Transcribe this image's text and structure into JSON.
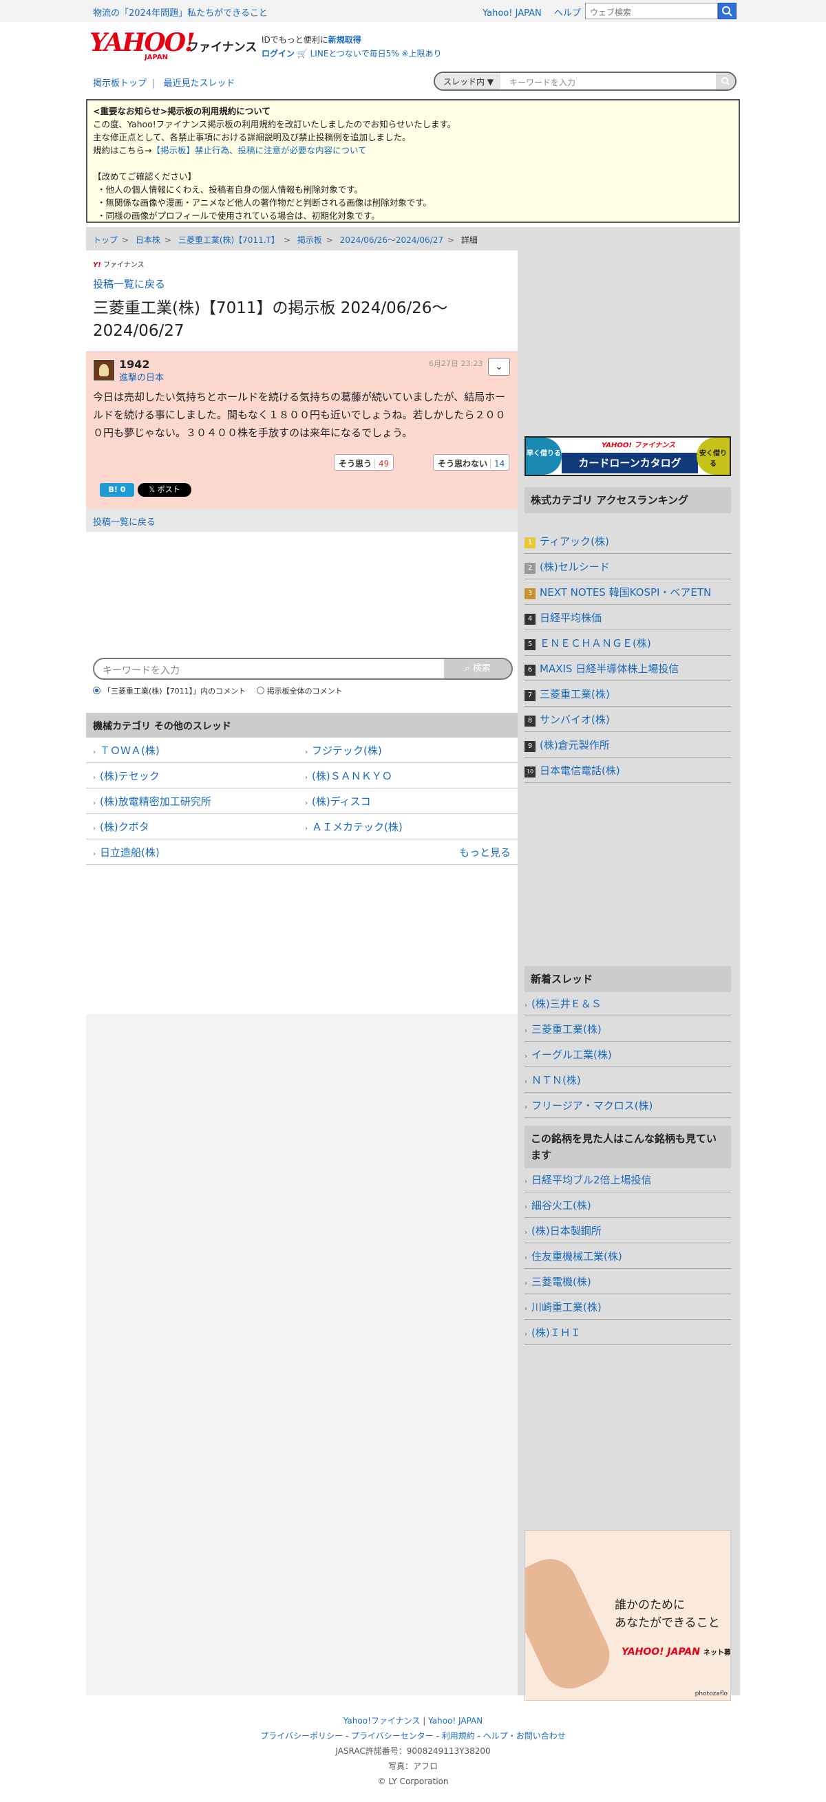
{
  "topbar": {
    "news": "物流の「2024年問題」私たちができること",
    "yahoo_japan": "Yahoo! JAPAN",
    "help": "ヘルプ",
    "search_placeholder": "ウェブ検索"
  },
  "header": {
    "logo_text": "YAHOO!",
    "logo_sub": "JAPAN",
    "finance": "ファイナンス",
    "promo_line1_a": "IDでもっと便利に",
    "promo_line1_b": "新規取得",
    "promo_login": "ログイン",
    "promo_line2": "LINEとつないで毎日5% ※上限あり",
    "nav_board_top": "掲示板トップ",
    "nav_recent": "最近見たスレッド",
    "scope": "スレッド内",
    "search_placeholder": "キーワードを入力"
  },
  "notice": {
    "title": "<重要なお知らせ>掲示板の利用規約について",
    "line1": "この度、Yahoo!ファイナンス掲示板の利用規約を改訂いたしましたのでお知らせいたします。",
    "line2": "主な修正点として、各禁止事項における詳細説明及び禁止投稿例を追加しました。",
    "line3_a": "規約はこちら→",
    "line3_b": "【掲示板】禁止行為、投稿に注意が必要な内容について",
    "confirm": "【改めてご確認ください】",
    "bullet1": "・他人の個人情報にくわえ、投稿者自身の個人情報も削除対象です。",
    "bullet2": "・無関係な画像や漫画・アニメなど他人の著作物だと判断される画像は削除対象です。",
    "bullet3": "・同様の画像がプロフィールで使用されている場合は、初期化対象です。"
  },
  "breadcrumb": [
    "トップ",
    "日本株",
    "三菱重工業(株)【7011.T】",
    "掲示板",
    "2024/06/26〜2024/06/27",
    "詳細"
  ],
  "main": {
    "brand": "ファイナンス",
    "back": "投稿一覧に戻る",
    "title": "三菱重工業(株)【7011】の掲示板 2024/06/26〜2024/06/27",
    "post": {
      "number": "1942",
      "user": "進撃の日本",
      "date": "6月27日 23:23",
      "body": "今日は売却したい気持ちとホールドを続ける気持ちの葛藤が続いていましたが、結局ホールドを続ける事にしました。間もなく１８００円も近いでしょうね。若しかしたら２０００円も夢じゃない。３０４００株を手放すのは来年になるでしょう。",
      "agree_label": "そう思う",
      "agree_count": "49",
      "disagree_label": "そう思わない",
      "disagree_count": "14",
      "hatena": "B! 0",
      "x_post": "ポスト"
    },
    "back2": "投稿一覧に戻る",
    "search_placeholder": "キーワードを入力",
    "search_button": "検索",
    "radio1": "「三菱重工業(株)【7011】」内のコメント",
    "radio2": "掲示板全体のコメント",
    "category_title": "機械カテゴリ その他のスレッド",
    "threads": [
      [
        "ＴＯＷＡ(株)",
        "フジテック(株)"
      ],
      [
        "(株)テセック",
        "(株)ＳＡＮＫＹＯ"
      ],
      [
        "(株)放電精密加工研究所",
        "(株)ディスコ"
      ],
      [
        "(株)クボタ",
        "ＡＩメカテック(株)"
      ]
    ],
    "last_thread": "日立造船(株)",
    "more": "もっと見る"
  },
  "side": {
    "ad1_left": "早く借りる",
    "ad1_center": "カードローンカタログ",
    "ad1_right": "安く借りる",
    "ad1_brand": "YAHOO! ファイナンス",
    "ranking_title": "株式カテゴリ アクセスランキング",
    "ranking": [
      "ティアック(株)",
      "(株)セルシード",
      "NEXT NOTES 韓国KOSPI・ベアETN",
      "日経平均株価",
      "ＥＮＥＣＨＡＮＧＥ(株)",
      "MAXIS 日経半導体株上場投信",
      "三菱重工業(株)",
      "サンバイオ(株)",
      "(株)倉元製作所",
      "日本電信電話(株)"
    ],
    "new_title": "新着スレッド",
    "new_threads": [
      "(株)三井Ｅ＆Ｓ",
      "三菱重工業(株)",
      "イーグル工業(株)",
      "ＮＴＮ(株)",
      "フリージア・マクロス(株)"
    ],
    "viewed_title": "この銘柄を見た人はこんな銘柄も見ています",
    "viewed": [
      "日経平均ブル2倍上場投信",
      "細谷火工(株)",
      "(株)日本製鋼所",
      "住友重機械工業(株)",
      "三菱電機(株)",
      "川崎重工業(株)",
      "(株)ＩＨＩ"
    ],
    "ad2_text1": "誰かのために",
    "ad2_text2": "あなたができること",
    "ad2_brand": "YAHOO! JAPAN",
    "ad2_sub": "ネット募金",
    "ad2_credit": "photozaflo"
  },
  "footer": {
    "l1a": "Yahoo!ファイナンス",
    "l1b": "Yahoo! JAPAN",
    "l2": [
      "プライバシーポリシー",
      "プライバシーセンター",
      "利用規約",
      "ヘルプ・お問い合わせ"
    ],
    "jasrac": "JASRAC許諾番号：9008249113Y38200",
    "photo": "写真：アフロ",
    "copy": "© LY Corporation"
  }
}
